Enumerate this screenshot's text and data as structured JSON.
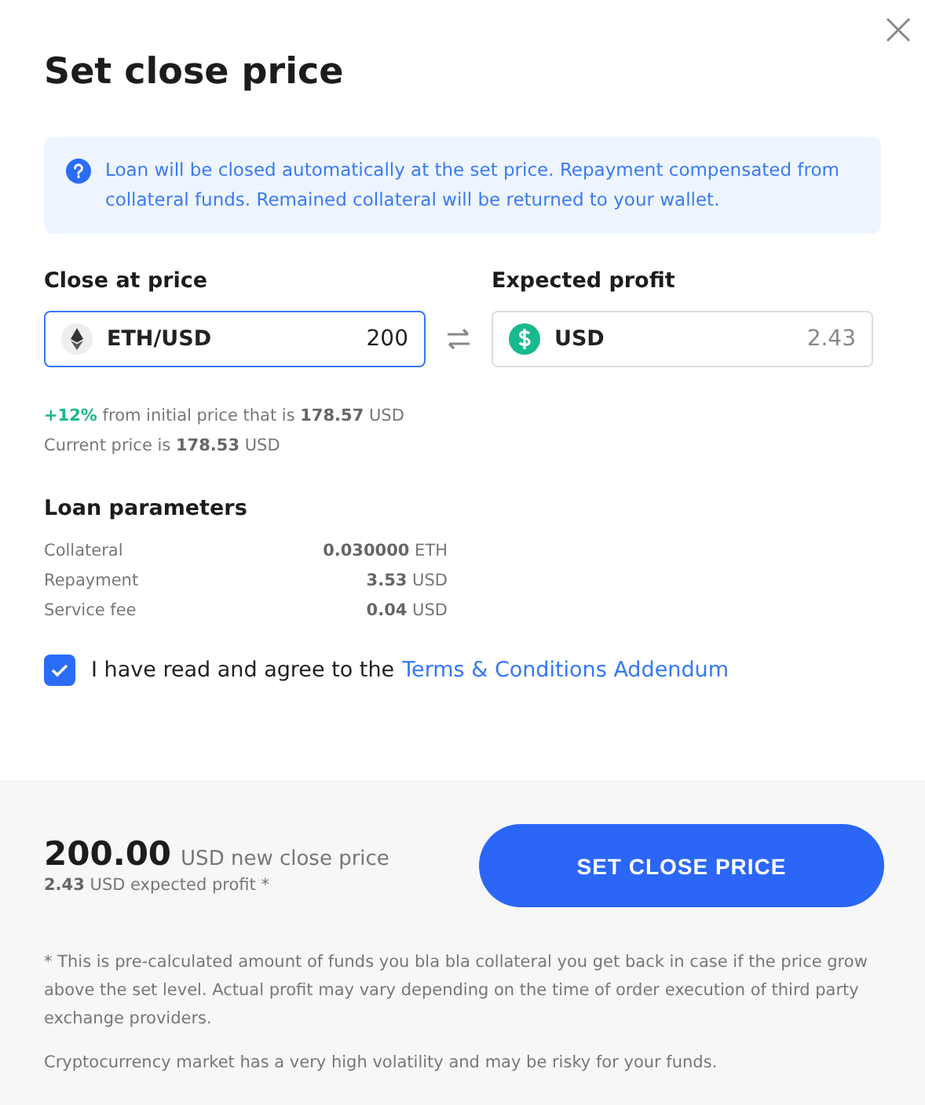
{
  "title": "Set close price",
  "info": "Loan will be closed automatically at the set price. Repayment compensated from collateral funds. Remained collateral will be returned to your wallet.",
  "close_at": {
    "label": "Close at price",
    "pair": "ETH/USD",
    "value": "200"
  },
  "profit": {
    "label": "Expected profit",
    "currency": "USD",
    "value": "2.43"
  },
  "change": {
    "percent": "+12%",
    "text": "from initial price that is **178.57** USD"
  },
  "current": "Current price is **178.53** USD",
  "loan": {
    "title": "Loan parameters",
    "rows": [
      {
        "label": "Collateral",
        "value": "**0.030000** ETH"
      },
      {
        "label": "Repayment",
        "value": "**3.53** USD"
      },
      {
        "label": "Service fee",
        "value": "**0.04** USD"
      }
    ]
  },
  "agree": {
    "checked": true,
    "text": "I have read and agree to the",
    "link": "Terms & Conditions Addendum"
  },
  "summary": {
    "price": "200.00",
    "caption": "USD new close price",
    "profit": "**2.43** USD expected profit *"
  },
  "button": "SET CLOSE PRICE",
  "notes": [
    "* This is pre-calculated amount of funds you bla bla collateral you get back in case if the price grow above the set level. Actual profit may vary depending on the time of order execution of third party exchange providers.",
    "Cryptocurrency market has a very high volatility and may be risky for your funds."
  ]
}
